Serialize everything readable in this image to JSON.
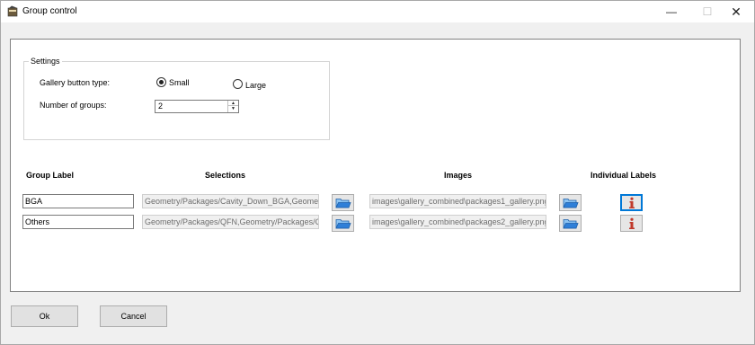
{
  "window": {
    "title": "Group control",
    "controls": {
      "minimize": "—",
      "maximize": "☐",
      "close": "✕"
    }
  },
  "settings": {
    "legend": "Settings",
    "gallery_button_type_label": "Gallery button type:",
    "options": [
      {
        "label": "Small",
        "checked": true
      },
      {
        "label": "Large",
        "checked": false
      }
    ],
    "num_groups_label": "Number of groups:",
    "num_groups_value": "2"
  },
  "columns": {
    "group_label": "Group Label",
    "selections": "Selections",
    "images": "Images",
    "individual_labels": "Individual Labels"
  },
  "groups": [
    {
      "label": "BGA",
      "selections": "Geometry/Packages/Cavity_Down_BGA,Geometry/",
      "image": "images\\gallery_combined\\packages1_gallery.png"
    },
    {
      "label": "Others",
      "selections": "Geometry/Packages/QFN,Geometry/Packages/QF",
      "image": "images\\gallery_combined\\packages2_gallery.png"
    }
  ],
  "buttons": {
    "ok": "Ok",
    "cancel": "Cancel"
  },
  "icons": {
    "browse": "folder-open-icon",
    "info": "info-icon",
    "app": "app-icon"
  },
  "colors": {
    "focus": "#0078d7",
    "info_red": "#c0392b",
    "folder_blue": "#2f7fd8"
  }
}
